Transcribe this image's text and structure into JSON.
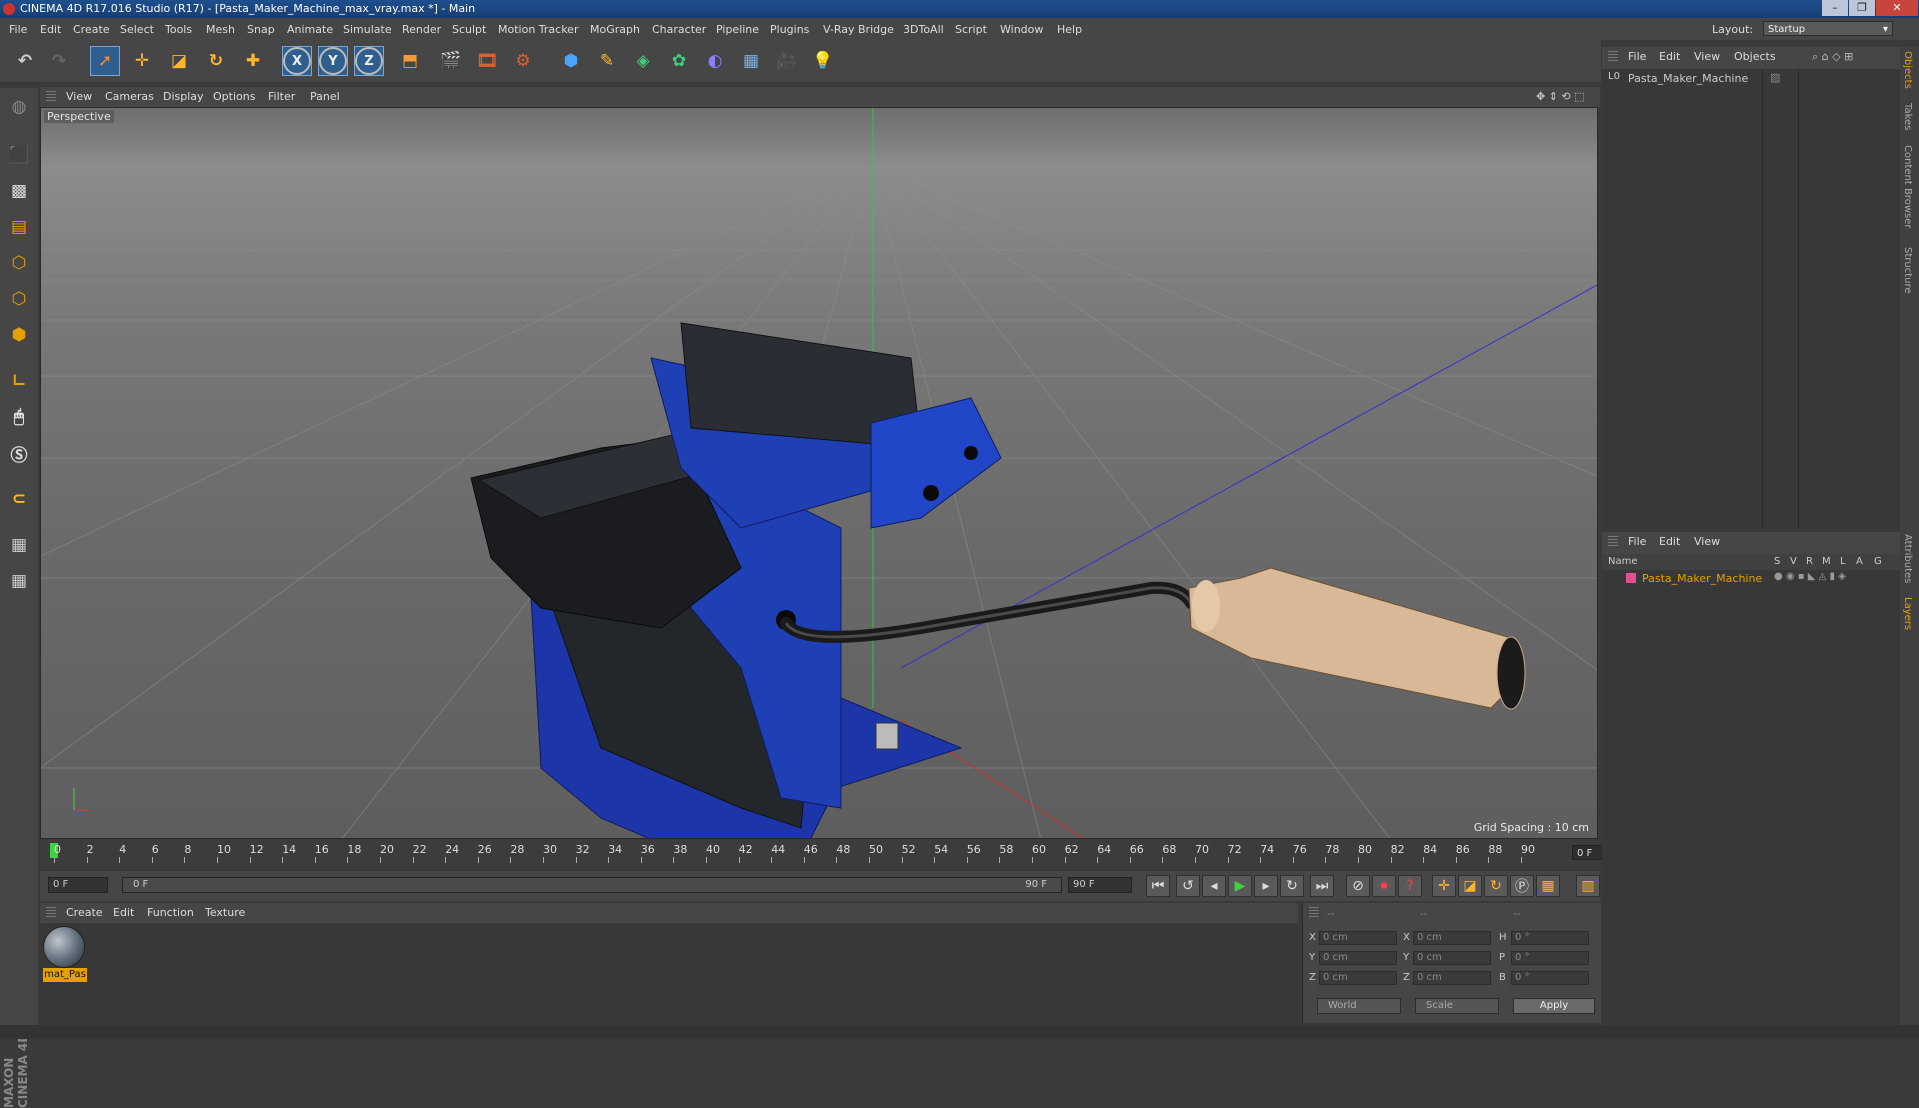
{
  "window": {
    "title": "CINEMA 4D R17.016 Studio (R17) - [Pasta_Maker_Machine_max_vray.max *] - Main",
    "controls": [
      "–",
      "❐",
      "✕"
    ]
  },
  "menubar": {
    "items": [
      "File",
      "Edit",
      "Create",
      "Select",
      "Tools",
      "Mesh",
      "Snap",
      "Animate",
      "Simulate",
      "Render",
      "Sculpt",
      "Motion Tracker",
      "MoGraph",
      "Character",
      "Pipeline",
      "Plugins",
      "V-Ray Bridge",
      "3DToAll",
      "Script",
      "Window",
      "Help"
    ],
    "layout_label": "Layout:",
    "layout_value": "Startup"
  },
  "toolbar": {
    "icons": [
      "undo-icon",
      "redo-icon",
      "live-selection-icon",
      "move-icon",
      "scale-icon",
      "rotate-icon",
      "last-tool-icon",
      "x-axis-icon",
      "y-axis-icon",
      "z-axis-icon",
      "coordinate-system-icon",
      "render-view-icon",
      "render-picture-viewer-icon",
      "edit-render-settings-icon",
      "cube-icon",
      "pen-spline-icon",
      "subdivision-surface-icon",
      "cloner-icon",
      "deformer-icon",
      "floor-icon",
      "camera-icon",
      "light-icon"
    ],
    "axis_x": "X",
    "axis_y": "Y",
    "axis_z": "Z"
  },
  "viewport": {
    "menu": [
      "View",
      "Cameras",
      "Display",
      "Options",
      "Filter",
      "Panel"
    ],
    "label": "Perspective",
    "grid_spacing": "Grid Spacing : 10 cm"
  },
  "timeline": {
    "ticks": [
      "0",
      "2",
      "4",
      "6",
      "8",
      "10",
      "12",
      "14",
      "16",
      "18",
      "20",
      "22",
      "24",
      "26",
      "28",
      "30",
      "32",
      "34",
      "36",
      "38",
      "40",
      "42",
      "44",
      "46",
      "48",
      "50",
      "52",
      "54",
      "56",
      "58",
      "60",
      "62",
      "64",
      "66",
      "68",
      "70",
      "72",
      "74",
      "76",
      "78",
      "80",
      "82",
      "84",
      "86",
      "88",
      "90"
    ],
    "current_frame": "0 F"
  },
  "transport": {
    "start_field": "0 F",
    "range_start": "0 F",
    "range_end": "90 F",
    "end_field": "90 F"
  },
  "materials": {
    "menu": [
      "Create",
      "Edit",
      "Function",
      "Texture"
    ],
    "items": [
      {
        "name": "mat_Pas"
      }
    ]
  },
  "coordinates": {
    "headers": [
      "--",
      "--",
      "--"
    ],
    "rows": [
      {
        "a": "X",
        "av": "0 cm",
        "b": "X",
        "bv": "0 cm",
        "c": "H",
        "cv": "0 °"
      },
      {
        "a": "Y",
        "av": "0 cm",
        "b": "Y",
        "bv": "0 cm",
        "c": "P",
        "cv": "0 °"
      },
      {
        "a": "Z",
        "av": "0 cm",
        "b": "Z",
        "bv": "0 cm",
        "c": "B",
        "cv": "0 °"
      }
    ],
    "mode_world": "World",
    "mode_scale": "Scale",
    "apply": "Apply"
  },
  "objects_panel": {
    "menu": [
      "File",
      "Edit",
      "View",
      "Objects"
    ],
    "items": [
      {
        "name": "Pasta_Maker_Machine"
      }
    ]
  },
  "layers_panel": {
    "menu": [
      "File",
      "Edit",
      "View"
    ],
    "columns": [
      "Name",
      "S",
      "V",
      "R",
      "M",
      "L",
      "A",
      "G"
    ],
    "items": [
      {
        "name": "Pasta_Maker_Machine",
        "color": "#e2508f"
      }
    ]
  },
  "side_tabs": [
    "Objects",
    "Takes",
    "Content Browser",
    "Structure",
    "Attributes",
    "Layers"
  ],
  "branding": {
    "maxon": "MAXON CINEMA 4D"
  },
  "colors": {
    "accent": "#e6a100",
    "selection": "#2e5f8f",
    "playhead": "#3fd13f",
    "machine_blue": "#1f3fb4"
  }
}
